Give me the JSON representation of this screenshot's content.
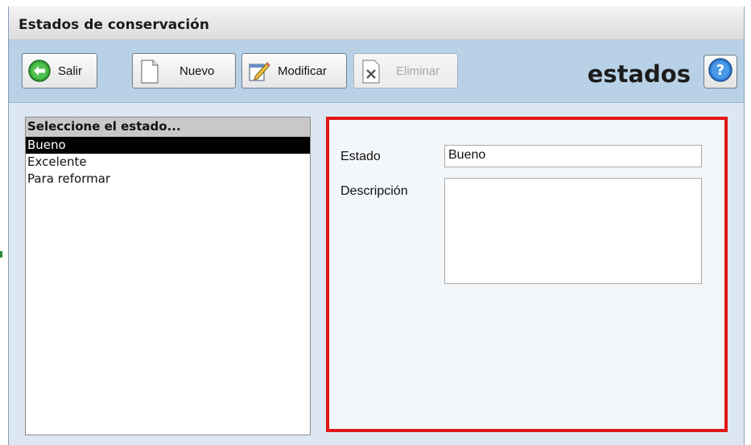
{
  "window": {
    "title": "Estados de conservación"
  },
  "toolbar": {
    "salir_label": "Salir",
    "nuevo_label": "Nuevo",
    "modificar_label": "Modificar",
    "eliminar_label": "Eliminar",
    "brand_text": "estados"
  },
  "list": {
    "header": "Seleccione el estado...",
    "items": [
      "Bueno",
      "Excelente",
      "Para reformar"
    ],
    "selected_index": 0
  },
  "form": {
    "estado_label": "Estado",
    "estado_value": "Bueno",
    "descripcion_label": "Descripción",
    "descripcion_value": ""
  },
  "colors": {
    "toolbar_bg": "#b8d1e6",
    "form_border": "#e01818",
    "selected_bg": "#000000"
  },
  "icons": {
    "salir": "green-back-arrow-icon",
    "nuevo": "blank-document-icon",
    "modificar": "edit-pencil-icon",
    "eliminar": "delete-x-icon",
    "help": "help-question-icon"
  }
}
